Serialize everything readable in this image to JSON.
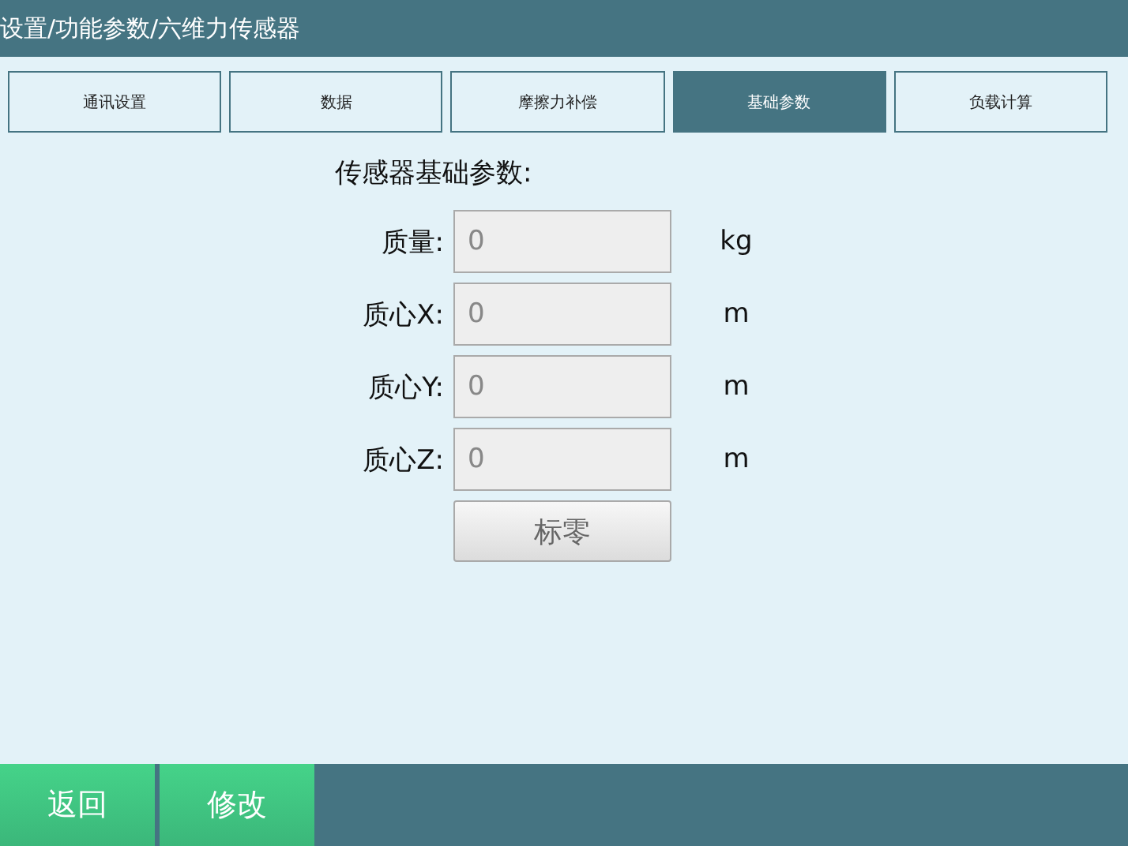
{
  "header": {
    "title": "设置/功能参数/六维力传感器"
  },
  "tabs": [
    {
      "label": "通讯设置",
      "selected": false
    },
    {
      "label": "数据",
      "selected": false
    },
    {
      "label": "摩擦力补偿",
      "selected": false
    },
    {
      "label": "基础参数",
      "selected": true
    },
    {
      "label": "负载计算",
      "selected": false
    }
  ],
  "section_title": "传感器基础参数:",
  "fields": [
    {
      "label": "质量:",
      "value": "0",
      "unit": "kg"
    },
    {
      "label": "质心X:",
      "value": "0",
      "unit": "m"
    },
    {
      "label": "质心Y:",
      "value": "0",
      "unit": "m"
    },
    {
      "label": "质心Z:",
      "value": "0",
      "unit": "m"
    }
  ],
  "zero_button": "标零",
  "footer_buttons": [
    "返回",
    "修改"
  ]
}
